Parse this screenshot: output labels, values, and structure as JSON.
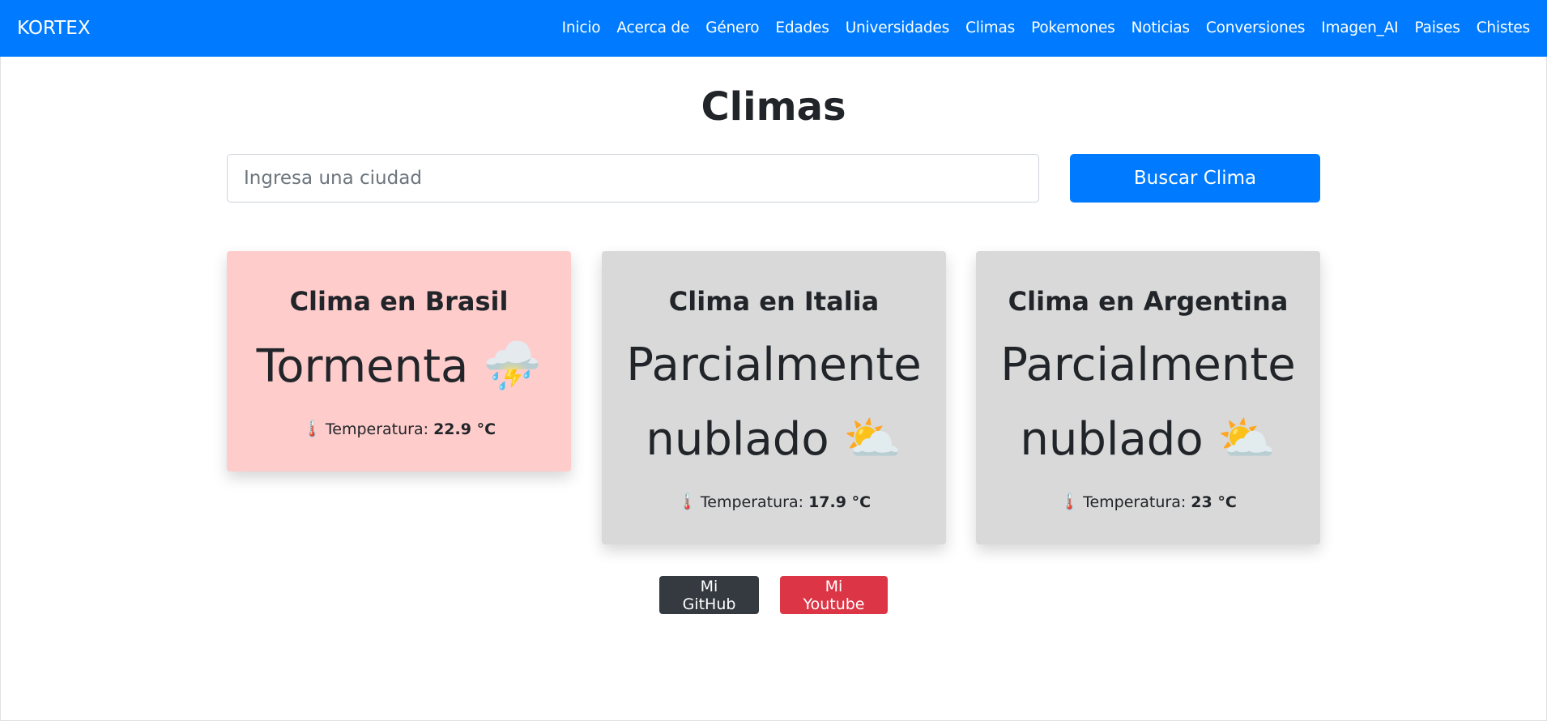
{
  "navbar": {
    "brand": "KORTEX",
    "links": [
      "Inicio",
      "Acerca de",
      "Género",
      "Edades",
      "Universidades",
      "Climas",
      "Pokemones",
      "Noticias",
      "Conversiones",
      "Imagen_AI",
      "Paises",
      "Chistes"
    ]
  },
  "page": {
    "title": "Climas"
  },
  "search": {
    "placeholder": "Ingresa una ciudad",
    "value": "",
    "button_label": "Buscar Clima"
  },
  "cards": [
    {
      "title": "Clima en Brasil",
      "condition": "Tormenta",
      "icon": "thunderstorm-rain-icon",
      "icon_glyph": "⛈️",
      "temp_label": "Temperatura:",
      "temp_value": "22.9 °C",
      "background": "#ffcccc"
    },
    {
      "title": "Clima en Italia",
      "condition": "Parcialmente nublado",
      "icon": "partly-cloudy-icon",
      "icon_glyph": "⛅",
      "temp_label": "Temperatura:",
      "temp_value": "17.9 °C",
      "background": "#d9d9d9"
    },
    {
      "title": "Clima en Argentina",
      "condition": "Parcialmente nublado",
      "icon": "partly-cloudy-icon",
      "icon_glyph": "⛅",
      "temp_label": "Temperatura:",
      "temp_value": "23 °C",
      "background": "#d9d9d9"
    }
  ],
  "thermometer_glyph": "🌡️",
  "footer": {
    "github_label": "Mi GitHub",
    "youtube_label": "Mi Youtube"
  },
  "colors": {
    "primary": "#007bff",
    "dark": "#343a40",
    "danger": "#dc3545"
  }
}
